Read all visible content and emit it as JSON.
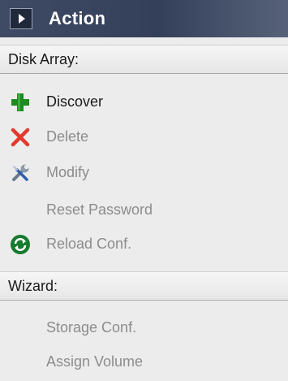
{
  "panel": {
    "title": "Action",
    "toggle_icon": "play-triangle-icon"
  },
  "sections": [
    {
      "header": "Disk Array:",
      "items": [
        {
          "label": "Discover",
          "icon": "plus-icon",
          "enabled": true
        },
        {
          "label": "Delete",
          "icon": "x-icon",
          "enabled": false
        },
        {
          "label": "Modify",
          "icon": "wrench-screwdriver-icon",
          "enabled": false
        },
        {
          "label": "Reset Password",
          "icon": "",
          "enabled": false
        },
        {
          "label": "Reload Conf.",
          "icon": "reload-arrows-icon",
          "enabled": false
        }
      ]
    },
    {
      "header": "Wizard:",
      "items": [
        {
          "label": "Storage Conf.",
          "icon": "",
          "enabled": false
        },
        {
          "label": "Assign Volume",
          "icon": "",
          "enabled": false
        }
      ]
    }
  ],
  "colors": {
    "title_bar": "#3f4a64",
    "enabled_text": "#1a1a1a",
    "disabled_text": "#8c8c8c",
    "plus_green": "#1f8a1f",
    "delete_red": "#e23b2e",
    "reload_green": "#177a2e"
  }
}
